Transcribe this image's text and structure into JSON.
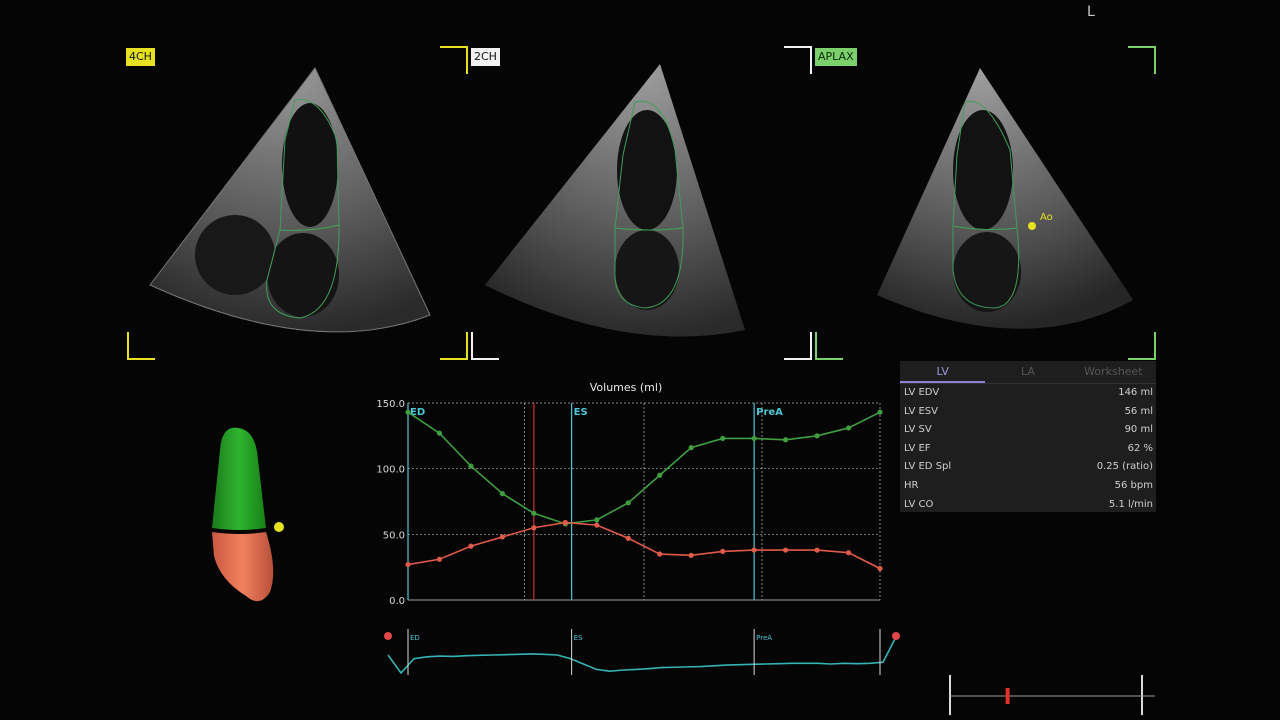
{
  "views": {
    "four_ch": {
      "label": "4CH"
    },
    "two_ch": {
      "label": "2CH"
    },
    "aplax": {
      "label": "APLAX",
      "marker_label": "Ao"
    }
  },
  "orientation_marker": "L",
  "chart_data": {
    "type": "line",
    "title": "Volumes (ml)",
    "xlabel": "",
    "ylabel": "",
    "ylim": [
      0,
      150
    ],
    "yticks": [
      "0.0",
      "50.0",
      "100.0",
      "150.0"
    ],
    "grid": true,
    "x": [
      0,
      1,
      2,
      3,
      4,
      5,
      6,
      7,
      8,
      9,
      10,
      11,
      12,
      13,
      14,
      15
    ],
    "series": [
      {
        "color": "#3f9e3f",
        "values": [
          143,
          127,
          102,
          81,
          66,
          58,
          61,
          74,
          95,
          116,
          123,
          123,
          122,
          125,
          131,
          143
        ]
      },
      {
        "color": "#e05a4a",
        "values": [
          27,
          31,
          41,
          48,
          55,
          59,
          57,
          47,
          35,
          34,
          37,
          38,
          38,
          38,
          36,
          24
        ]
      }
    ],
    "markers": [
      {
        "label": "ED",
        "x": 0,
        "color": "#4fc6d6"
      },
      {
        "label": "ES",
        "x": 5.2,
        "color": "#4fc6d6"
      },
      {
        "label": "PreA",
        "x": 11.0,
        "color": "#4fc6d6"
      }
    ],
    "red_marker_x": 4.0,
    "dashed_gridlines_x": [
      3.7,
      7.5,
      11.25
    ]
  },
  "ecg": {
    "labels": [
      "ED",
      "ES",
      "PreA"
    ],
    "values": [
      0.5,
      0.0,
      0.4,
      0.45,
      0.47,
      0.46,
      0.48,
      0.49,
      0.5,
      0.51,
      0.52,
      0.53,
      0.52,
      0.5,
      0.4,
      0.25,
      0.1,
      0.05,
      0.08,
      0.1,
      0.12,
      0.15,
      0.16,
      0.17,
      0.18,
      0.2,
      0.22,
      0.23,
      0.24,
      0.25,
      0.26,
      0.27,
      0.27,
      0.27,
      0.25,
      0.27,
      0.26,
      0.27,
      0.3,
      1.0
    ]
  },
  "results": {
    "tabs": [
      "LV",
      "LA",
      "Worksheet"
    ],
    "active_tab": "LV",
    "rows": [
      {
        "name": "LV EDV",
        "value": "146 ml"
      },
      {
        "name": "LV ESV",
        "value": "56 ml"
      },
      {
        "name": "LV SV",
        "value": "90 ml"
      },
      {
        "name": "LV EF",
        "value": "62 %"
      },
      {
        "name": "LV ED Spl",
        "value": "0.25 (ratio)"
      },
      {
        "name": "HR",
        "value": "56 bpm"
      },
      {
        "name": "LV CO",
        "value": "5.1 l/min"
      }
    ]
  },
  "timeline": {
    "position": 0.3
  }
}
